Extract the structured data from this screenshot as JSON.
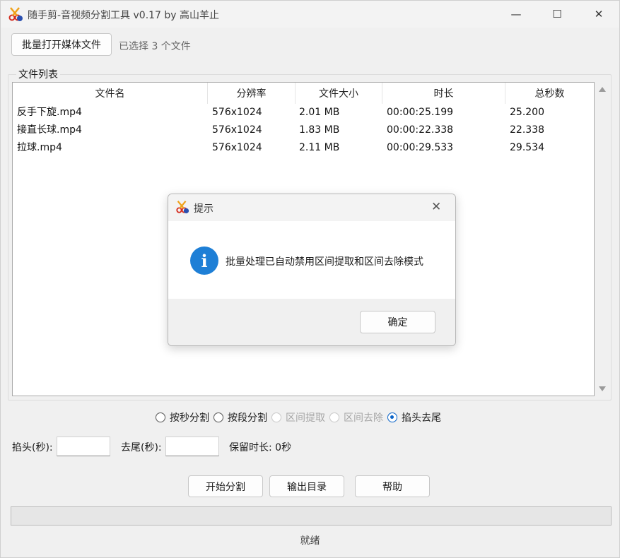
{
  "window": {
    "title": "随手剪-音视频分割工具 v0.17 by 高山羊止",
    "controls": {
      "minimize": "—",
      "maximize": "☐",
      "close": "✕"
    }
  },
  "toolbar": {
    "open_button": "批量打开媒体文件",
    "selection_text": "已选择 3 个文件"
  },
  "file_list": {
    "group_label": "文件列表",
    "columns": [
      "文件名",
      "分辨率",
      "文件大小",
      "时长",
      "总秒数"
    ],
    "rows": [
      [
        "反手下旋.mp4",
        "576x1024",
        "2.01 MB",
        "00:00:25.199",
        "25.200"
      ],
      [
        "接直长球.mp4",
        "576x1024",
        "1.83 MB",
        "00:00:22.338",
        "22.338"
      ],
      [
        "拉球.mp4",
        "576x1024",
        "2.11 MB",
        "00:00:29.533",
        "29.534"
      ]
    ]
  },
  "modes": [
    {
      "label": "按秒分割",
      "checked": false,
      "disabled": false
    },
    {
      "label": "按段分割",
      "checked": false,
      "disabled": false
    },
    {
      "label": "区间提取",
      "checked": false,
      "disabled": true
    },
    {
      "label": "区间去除",
      "checked": false,
      "disabled": true
    },
    {
      "label": "掐头去尾",
      "checked": true,
      "disabled": false
    }
  ],
  "trim": {
    "head_label": "掐头(秒):",
    "head_value": "",
    "tail_label": "去尾(秒):",
    "tail_value": "",
    "keep_text": "保留时长: 0秒"
  },
  "actions": {
    "start": "开始分割",
    "output": "输出目录",
    "help": "帮助"
  },
  "progress": 0,
  "status": "就绪",
  "dialog": {
    "title": "提示",
    "message": "批量处理已自动禁用区间提取和区间去除模式",
    "ok": "确定",
    "close": "✕",
    "info_glyph": "i"
  },
  "colors": {
    "accent": "#0a64c8",
    "info": "#1e7fd6"
  },
  "icons": {
    "app": "scissors-film-icon",
    "dialog": "info-icon"
  }
}
